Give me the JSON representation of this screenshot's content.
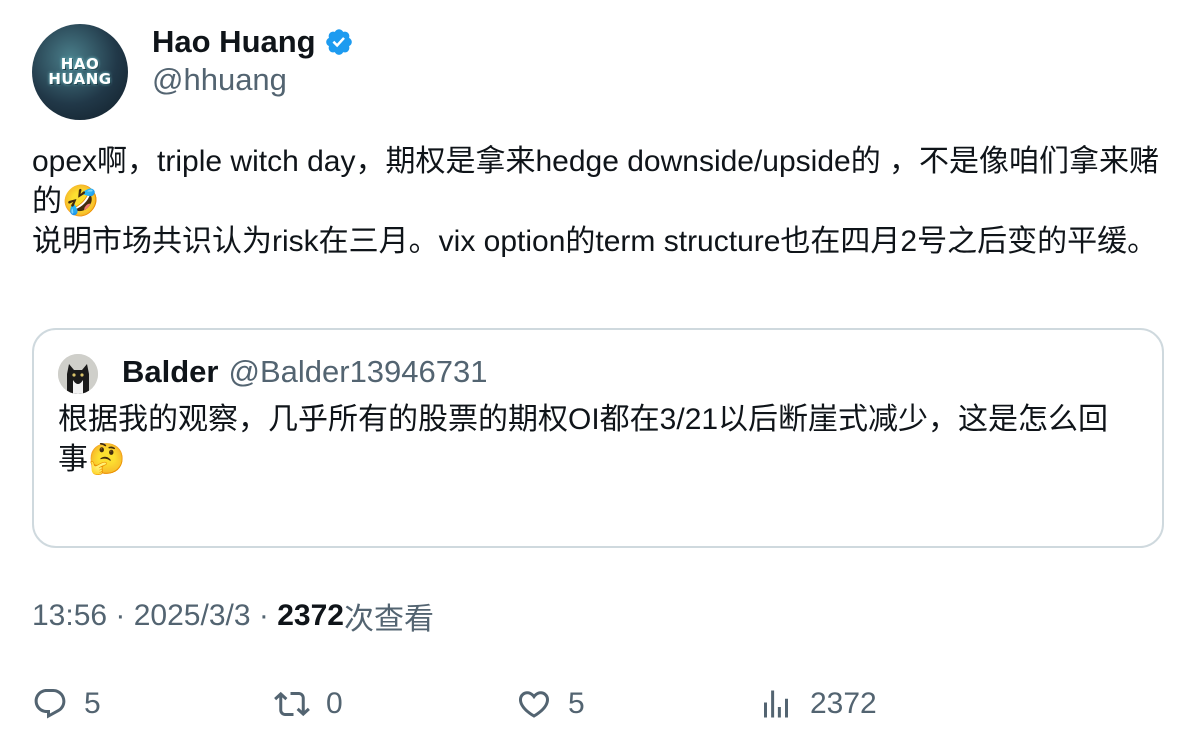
{
  "tweet": {
    "author": {
      "display_name": "Hao Huang",
      "handle": "@hhuang",
      "avatar_text_line1": "HAO",
      "avatar_text_line2": "HUANG",
      "verified": true
    },
    "text": "opex啊，triple witch day，期权是拿来hedge downside/upside的 ，不是像咱们拿来赌的🤣\n说明市场共识认为risk在三月。vix option的term structure也在四月2号之后变的平缓。",
    "quoted": {
      "author": {
        "display_name": "Balder",
        "handle": "@Balder13946731"
      },
      "text": "根据我的观察，几乎所有的股票的期权OI都在3/21以后断崖式减少，这是怎么回事🤔"
    },
    "meta": {
      "time": "13:56",
      "sep1": " · ",
      "date": "2025/3/3",
      "sep2": " · ",
      "views": "2372",
      "views_label": "次查看"
    },
    "actions": {
      "replies": "5",
      "reposts": "0",
      "likes": "5",
      "views": "2372"
    }
  },
  "colors": {
    "text_primary": "#0f1419",
    "text_secondary": "#536471",
    "border": "#cfd9de",
    "verified_blue": "#1d9bf0"
  },
  "icons": {
    "verified": "verified-badge-icon",
    "reply": "reply-icon",
    "repost": "repost-icon",
    "like": "heart-icon",
    "views": "analytics-icon"
  }
}
